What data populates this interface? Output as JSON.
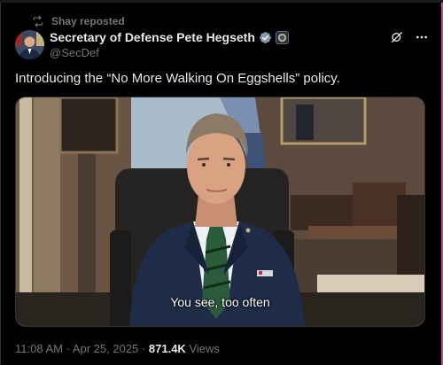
{
  "repost": {
    "label": "Shay reposted",
    "icon": "repost-icon"
  },
  "author": {
    "display_name": "Secretary of Defense Pete Hegseth",
    "handle": "@SecDef",
    "verified_badge": "verified-badge-icon",
    "affiliate_badge": "government-seal-icon"
  },
  "actions": {
    "grok_icon": "grok-icon",
    "more_icon": "more-icon"
  },
  "tweet": {
    "text": "Introducing the “No More Walking On Eggshells” policy."
  },
  "media": {
    "caption": "You see, too often"
  },
  "meta": {
    "time": "11:08 AM",
    "separator": "·",
    "date": "Apr 25, 2025",
    "views_count": "871.4K",
    "views_label": "Views"
  },
  "colors": {
    "background": "#000000",
    "text": "#e7e9ea",
    "muted": "#71767b",
    "verified": "#1d9bf0"
  }
}
